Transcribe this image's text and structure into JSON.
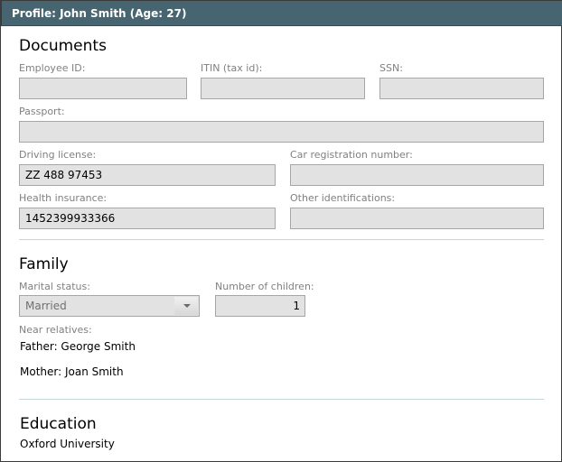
{
  "window": {
    "title": "Profile: John Smith (Age: 27)",
    "header_color": "#476570"
  },
  "documents": {
    "heading": "Documents",
    "employee_id": {
      "label": "Employee ID:",
      "value": ""
    },
    "itin": {
      "label": "ITIN (tax id):",
      "value": ""
    },
    "ssn": {
      "label": "SSN:",
      "value": ""
    },
    "passport": {
      "label": "Passport:",
      "value": ""
    },
    "driving_license": {
      "label": "Driving license:",
      "value": "ZZ 488 97453"
    },
    "car_registration": {
      "label": "Car registration number:",
      "value": ""
    },
    "health_insurance": {
      "label": "Health insurance:",
      "value": "1452399933366"
    },
    "other_identifications": {
      "label": "Other identifications:",
      "value": ""
    }
  },
  "family": {
    "heading": "Family",
    "marital_status": {
      "label": "Marital status:",
      "value": "Married",
      "icon": "chevron-down-icon"
    },
    "children": {
      "label": "Number of children:",
      "value": "1"
    },
    "near_relatives": {
      "label": "Near relatives:",
      "items": [
        "Father: George Smith",
        "Mother: Joan Smith"
      ]
    }
  },
  "education": {
    "heading": "Education",
    "value": "Oxford University"
  }
}
